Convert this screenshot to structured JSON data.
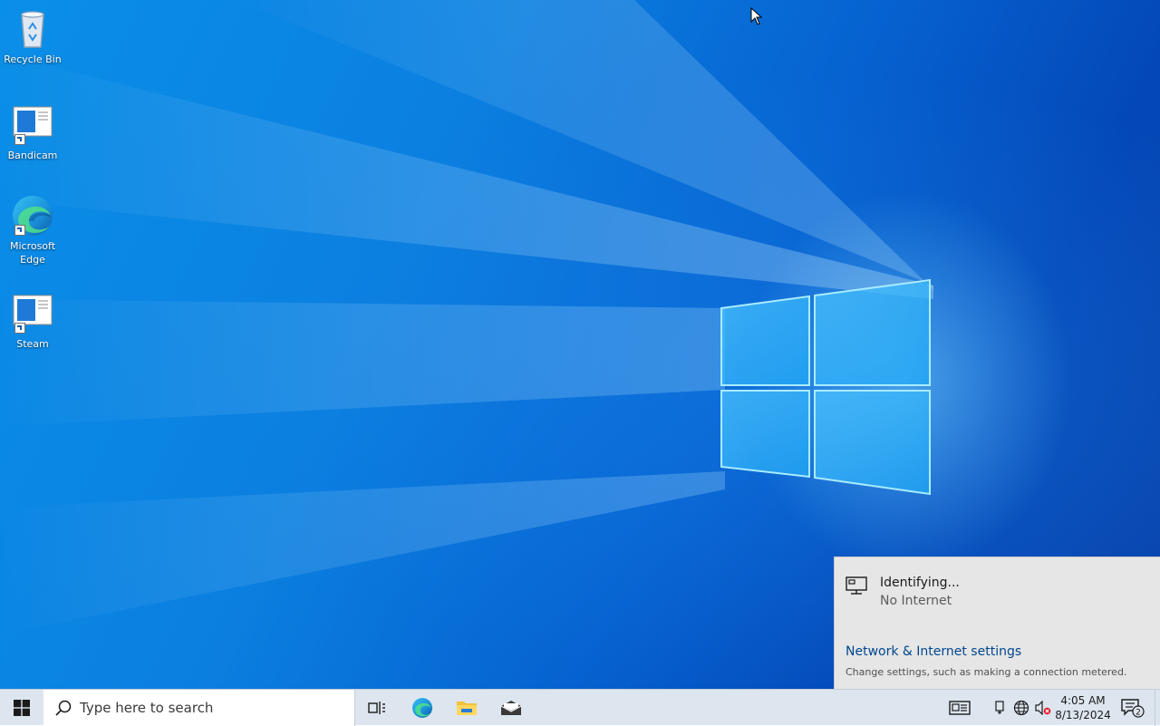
{
  "desktop": {
    "icons": [
      {
        "label": "Recycle Bin",
        "icon": "recycle-bin-icon"
      },
      {
        "label": "Bandicam",
        "icon": "shortcut-app-icon"
      },
      {
        "label": "Microsoft\nEdge",
        "icon": "edge-icon"
      },
      {
        "label": "Steam",
        "icon": "shortcut-app-icon"
      }
    ]
  },
  "network_flyout": {
    "status": "Identifying...",
    "substatus": "No Internet",
    "settings_link": "Network & Internet settings",
    "settings_desc": "Change settings, such as making a connection metered.",
    "network_icon": "ethernet-computer-icon"
  },
  "taskbar": {
    "start_icon": "windows-start-icon",
    "search_placeholder": "Type here to search",
    "pinned": [
      {
        "name": "Task View",
        "icon": "task-view-icon"
      },
      {
        "name": "Microsoft Edge",
        "icon": "edge-icon"
      },
      {
        "name": "File Explorer",
        "icon": "folder-icon"
      },
      {
        "name": "Mail",
        "icon": "mail-icon"
      }
    ],
    "tray": {
      "news_icon": "news-interests-icon",
      "devices_icon": "device-icon",
      "network_icon": "globe-network-icon",
      "volume_icon": "volume-muted-icon"
    },
    "clock": {
      "time": "4:05 AM",
      "date": "8/13/2024"
    },
    "notifications": {
      "count": "2",
      "icon": "action-center-icon"
    }
  },
  "colors": {
    "taskbar_bg": "#dde6ef",
    "flyout_bg": "#e6e6e6",
    "link": "#00468f",
    "desktop_blue": "#0b7fe0"
  }
}
